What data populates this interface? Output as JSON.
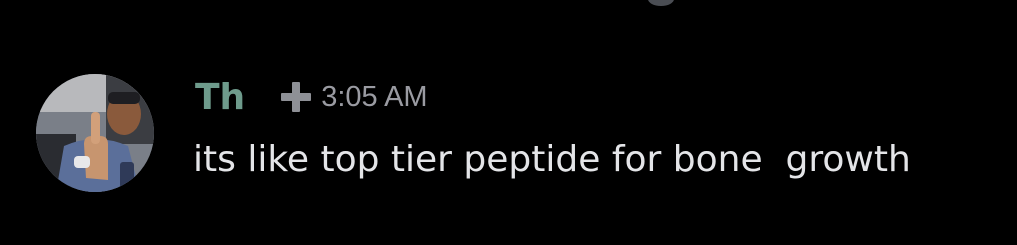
{
  "message": {
    "author": {
      "name": "Th",
      "name_color": "#6e9b8c",
      "role_icon": "plus-icon"
    },
    "timestamp": "3:05 AM",
    "content": "its like top tier peptide for bone  growth"
  },
  "theme": {
    "background": "#000000",
    "text": "#e4e5e8",
    "muted": "#9a9ba2"
  }
}
